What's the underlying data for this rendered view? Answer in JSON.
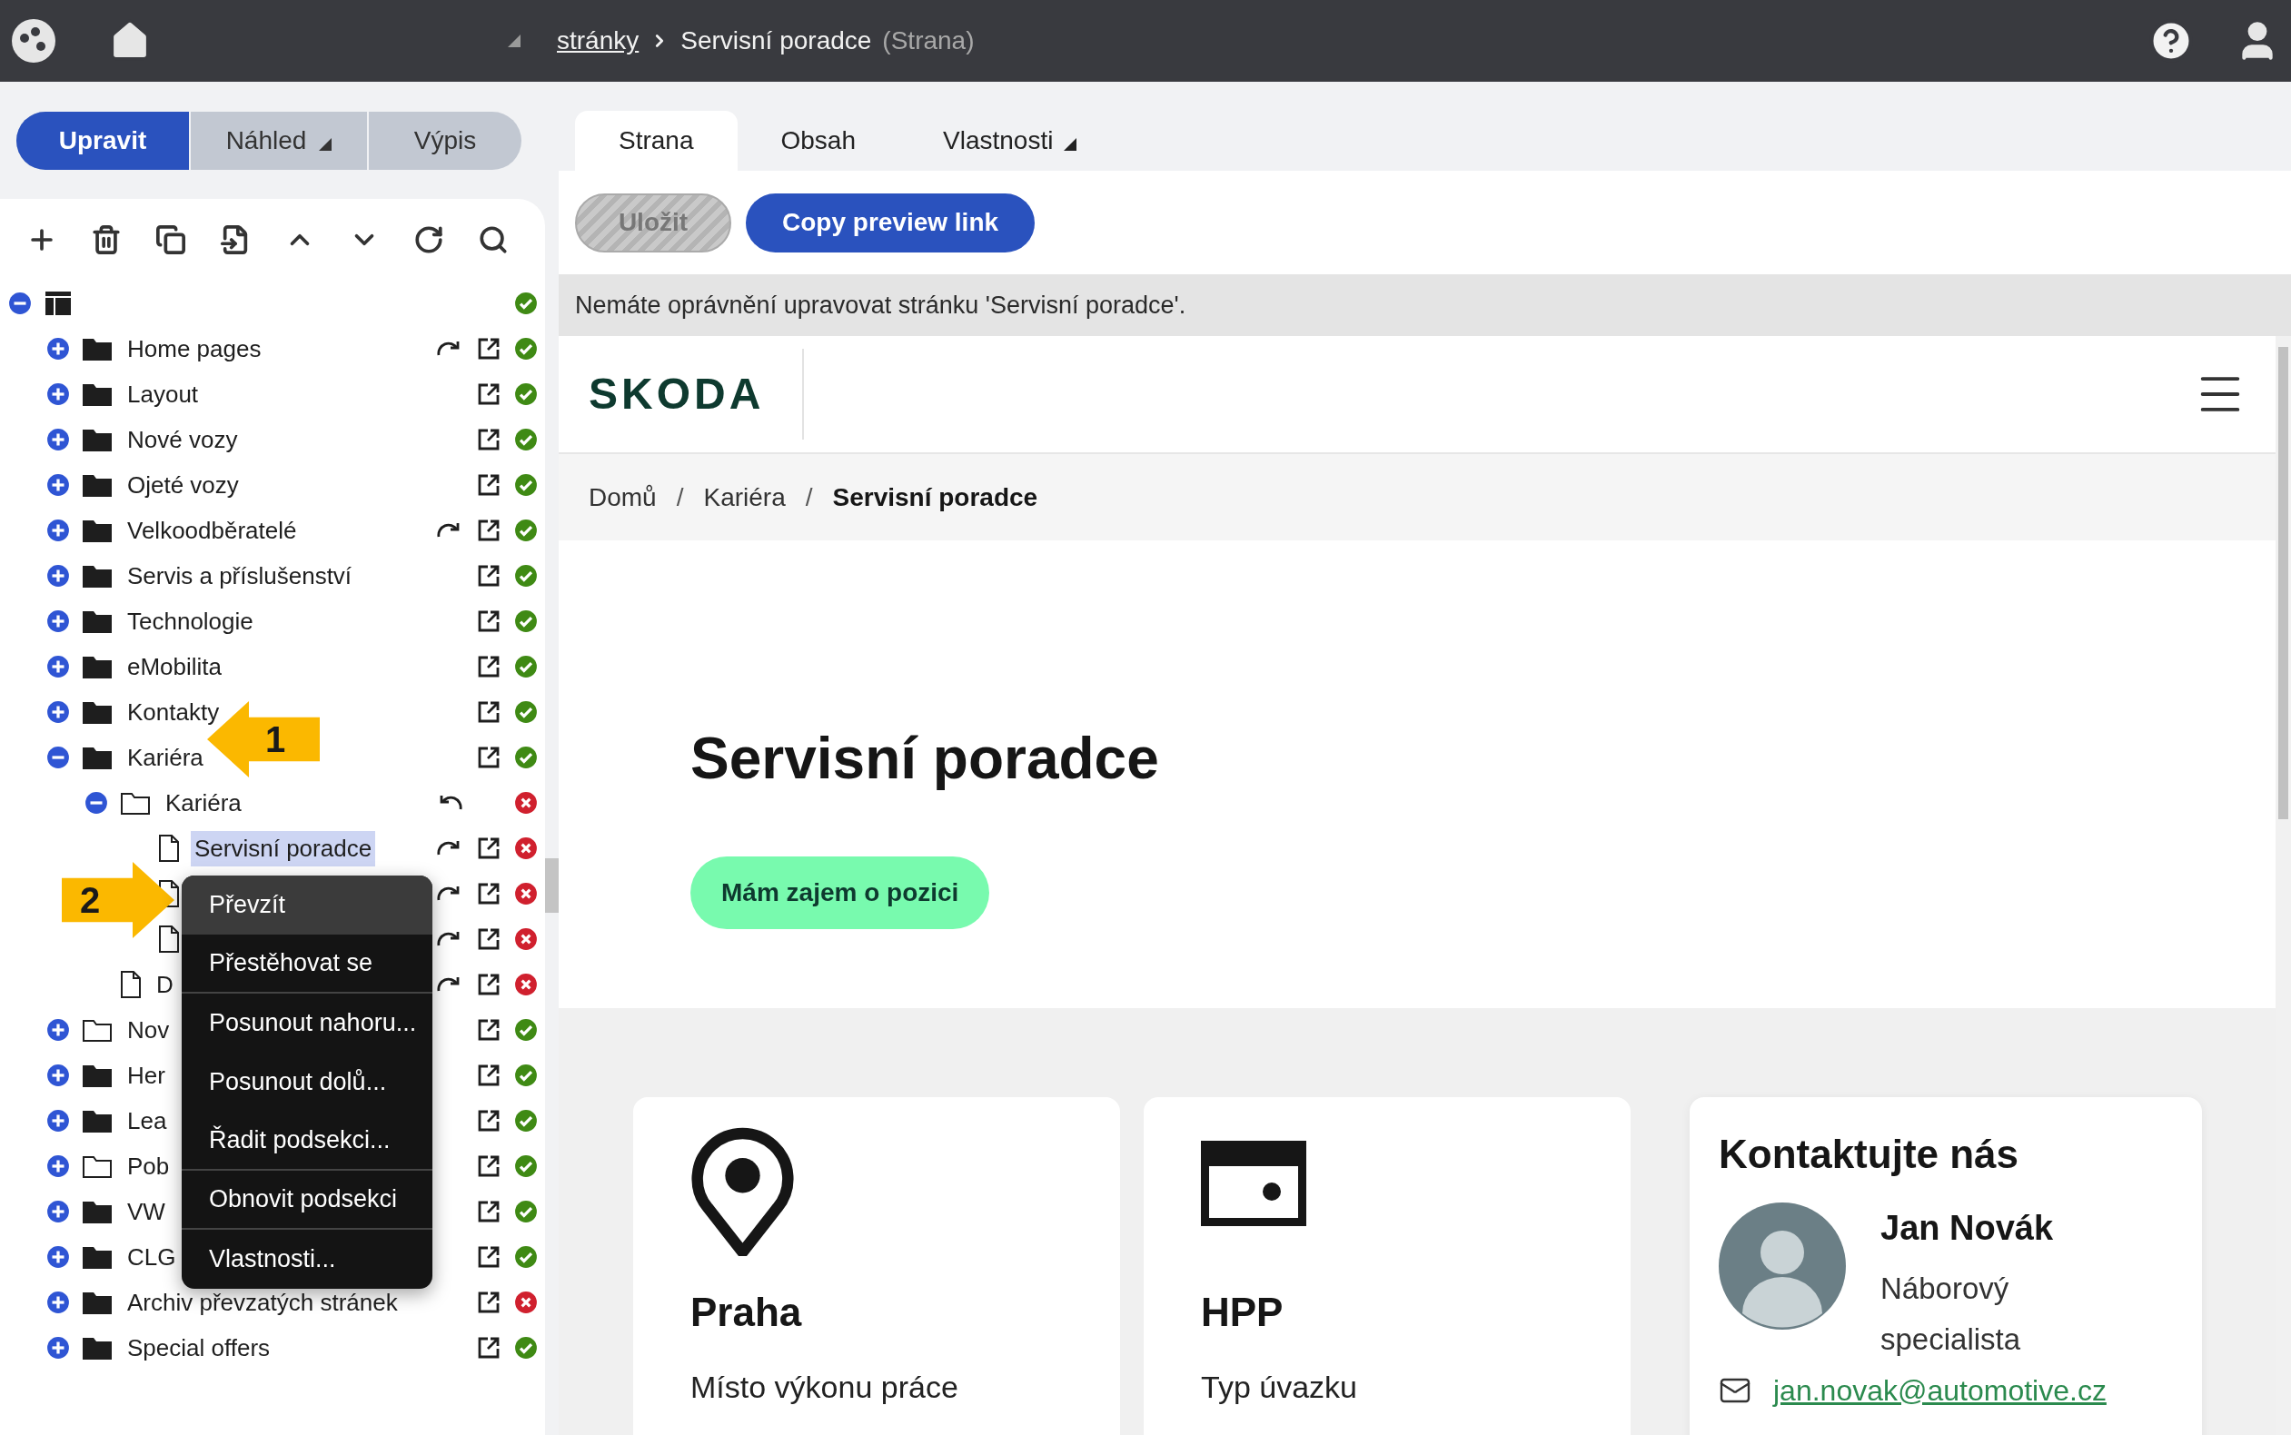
{
  "topbar": {
    "breadcrumb": [
      {
        "label": "stránky",
        "kind": "link"
      },
      {
        "label": "Servisní poradce",
        "kind": "current"
      }
    ],
    "suffix": "(Strana)"
  },
  "mode_buttons": [
    {
      "label": "Upravit",
      "selected": true,
      "dropdown": false
    },
    {
      "label": "Náhled",
      "selected": false,
      "dropdown": true
    },
    {
      "label": "Výpis",
      "selected": false,
      "dropdown": false
    }
  ],
  "tree": [
    {
      "kind": "root",
      "expanded": true,
      "redirect": false,
      "undo": false,
      "external": false,
      "published": true,
      "children": [
        {
          "label": "Home pages",
          "kind": "folder",
          "expanded": false,
          "selected": false,
          "redirect": true,
          "undo": false,
          "external": true,
          "published": true
        },
        {
          "label": "Layout",
          "kind": "folder",
          "expanded": false,
          "selected": false,
          "redirect": false,
          "undo": false,
          "external": true,
          "published": true
        },
        {
          "label": "Nové vozy",
          "kind": "folder",
          "expanded": false,
          "selected": false,
          "redirect": false,
          "undo": false,
          "external": true,
          "published": true
        },
        {
          "label": "Ojeté vozy",
          "kind": "folder",
          "expanded": false,
          "selected": false,
          "redirect": false,
          "undo": false,
          "external": true,
          "published": true
        },
        {
          "label": "Velkoodběratelé",
          "kind": "folder",
          "expanded": false,
          "selected": false,
          "redirect": true,
          "undo": false,
          "external": true,
          "published": true
        },
        {
          "label": "Servis a příslušenství",
          "kind": "folder",
          "expanded": false,
          "selected": false,
          "redirect": false,
          "undo": false,
          "external": true,
          "published": true
        },
        {
          "label": "Technologie",
          "kind": "folder",
          "expanded": false,
          "selected": false,
          "redirect": false,
          "undo": false,
          "external": true,
          "published": true
        },
        {
          "label": "eMobilita",
          "kind": "folder",
          "expanded": false,
          "selected": false,
          "redirect": false,
          "undo": false,
          "external": true,
          "published": true
        },
        {
          "label": "Kontakty",
          "kind": "folder",
          "expanded": false,
          "selected": false,
          "redirect": false,
          "undo": false,
          "external": true,
          "published": true
        },
        {
          "label": "Kariéra",
          "kind": "folder",
          "expanded": true,
          "selected": false,
          "redirect": false,
          "undo": false,
          "external": true,
          "published": true,
          "children": [
            {
              "label": "Kariéra",
              "kind": "folder-outline",
              "expanded": true,
              "selected": false,
              "redirect": false,
              "undo": true,
              "external": false,
              "published": false,
              "children": [
                {
                  "label": "Servisní poradce",
                  "kind": "page",
                  "selected": true,
                  "redirect": true,
                  "undo": false,
                  "external": true,
                  "published": false
                },
                {
                  "kind": "page",
                  "redirect": true,
                  "undo": false,
                  "external": true,
                  "published": false
                },
                {
                  "kind": "page",
                  "redirect": true,
                  "undo": false,
                  "external": true,
                  "published": false
                }
              ]
            },
            {
              "label": "D",
              "kind": "page",
              "selected": false,
              "redirect": true,
              "undo": false,
              "external": true,
              "published": false
            }
          ]
        },
        {
          "label": "Nov",
          "kind": "folder-outline",
          "expanded": false,
          "selected": false,
          "redirect": false,
          "undo": false,
          "external": true,
          "published": true
        },
        {
          "label": "Her",
          "kind": "folder",
          "expanded": false,
          "selected": false,
          "redirect": false,
          "undo": false,
          "external": true,
          "published": true
        },
        {
          "label": "Lea",
          "kind": "folder",
          "expanded": false,
          "selected": false,
          "redirect": false,
          "undo": false,
          "external": true,
          "published": true
        },
        {
          "label": "Pob",
          "kind": "folder-outline",
          "expanded": false,
          "selected": false,
          "redirect": false,
          "undo": false,
          "external": true,
          "published": true
        },
        {
          "label": "VW",
          "kind": "folder",
          "expanded": false,
          "selected": false,
          "redirect": false,
          "undo": false,
          "external": true,
          "published": true
        },
        {
          "label": "CLG",
          "kind": "folder",
          "expanded": false,
          "selected": false,
          "redirect": false,
          "undo": false,
          "external": true,
          "published": true
        },
        {
          "label": "Archiv převzatých stránek",
          "kind": "folder",
          "expanded": false,
          "selected": false,
          "redirect": false,
          "undo": false,
          "external": true,
          "published": false
        },
        {
          "label": "Special offers",
          "kind": "folder",
          "expanded": false,
          "selected": false,
          "redirect": false,
          "undo": false,
          "external": true,
          "published": true
        }
      ]
    }
  ],
  "context_menu": [
    {
      "label": "Převzít",
      "highlighted": true,
      "divider_after": false
    },
    {
      "label": "Přestěhovat se",
      "highlighted": false,
      "divider_after": true
    },
    {
      "label": "Posunout nahoru...",
      "highlighted": false,
      "divider_after": false
    },
    {
      "label": "Posunout dolů...",
      "highlighted": false,
      "divider_after": false
    },
    {
      "label": "Řadit podsekci...",
      "highlighted": false,
      "divider_after": true
    },
    {
      "label": "Obnovit podsekci",
      "highlighted": false,
      "divider_after": true
    },
    {
      "label": "Vlastnosti...",
      "highlighted": false,
      "divider_after": false
    }
  ],
  "callouts": [
    {
      "number": "1"
    },
    {
      "number": "2"
    }
  ],
  "tabs": [
    {
      "label": "Strana",
      "selected": true,
      "dropdown": false
    },
    {
      "label": "Obsah",
      "selected": false,
      "dropdown": false
    },
    {
      "label": "Vlastnosti",
      "selected": false,
      "dropdown": true
    }
  ],
  "actions": [
    {
      "label": "Uložit",
      "disabled": true
    },
    {
      "label": "Copy preview link",
      "disabled": false
    }
  ],
  "notice": "Nemáte oprávnění upravovat stránku 'Servisní poradce'.",
  "preview": {
    "logo": "SKODA",
    "separator": "/",
    "breadcrumb": [
      {
        "label": "Domů",
        "current": false
      },
      {
        "label": "Kariéra",
        "current": false
      },
      {
        "label": "Servisní poradce",
        "current": true
      }
    ],
    "heading": "Servisní poradce",
    "cta": "Mám zajem o pozici",
    "cards": [
      {
        "kind": "location",
        "title": "Praha",
        "caption": "Místo výkonu práce"
      },
      {
        "kind": "contract",
        "title": "HPP",
        "caption": "Typ úvazku"
      }
    ],
    "contact": {
      "title": "Kontaktujte nás",
      "name": "Jan Novák",
      "role": "Náborový specialista",
      "email": "jan.novak@automotive.cz"
    }
  }
}
